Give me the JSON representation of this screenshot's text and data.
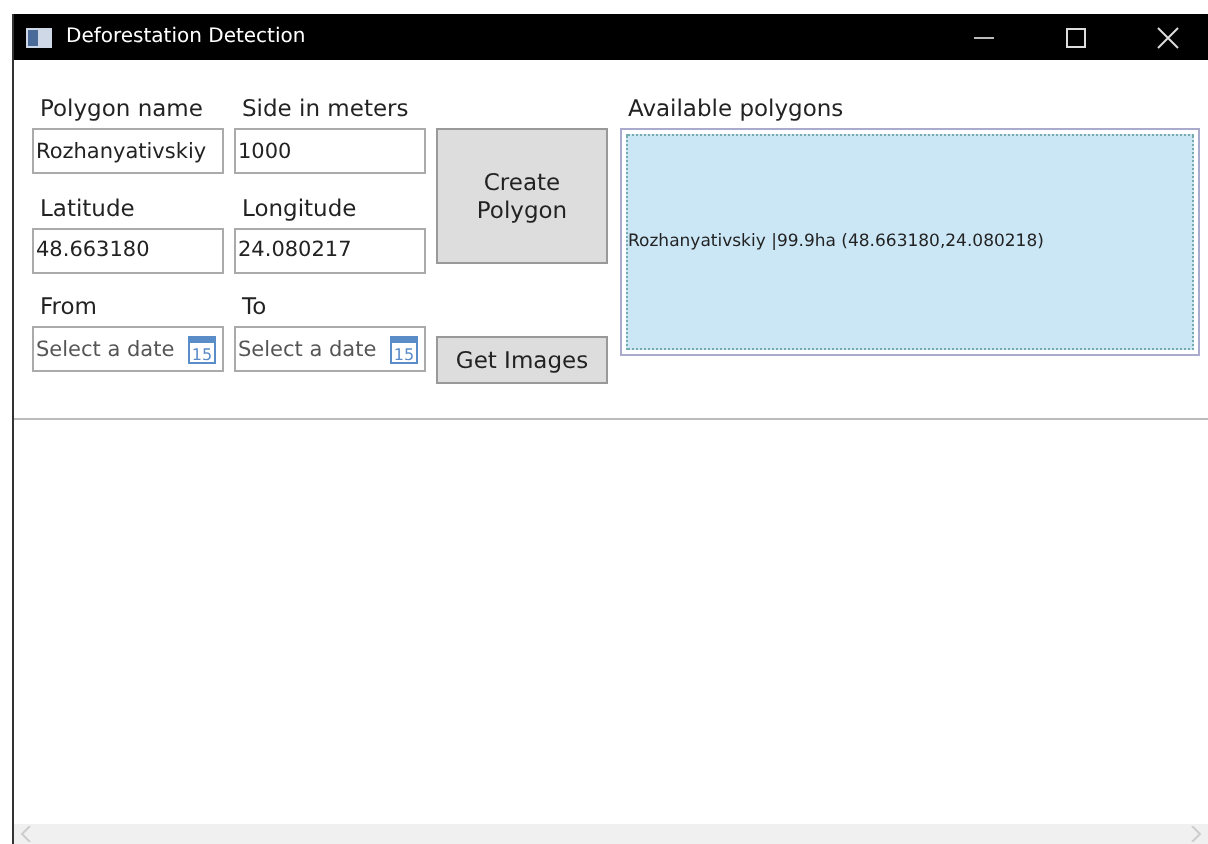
{
  "window": {
    "title": "Deforestation Detection"
  },
  "fields": [
    {
      "label": "Polygon name",
      "value": "Rozhanyativskiy",
      "kind": "text"
    },
    {
      "label": "Side in meters",
      "value": "1000",
      "kind": "text"
    },
    {
      "label": "Latitude",
      "value": "48.663180",
      "kind": "text"
    },
    {
      "label": "Longitude",
      "value": "24.080217",
      "kind": "text"
    },
    {
      "label": "From",
      "placeholder": "Select a date",
      "icon_text": "15",
      "kind": "date"
    },
    {
      "label": "To",
      "placeholder": "Select a date",
      "icon_text": "15",
      "kind": "date"
    }
  ],
  "buttons": [
    "Create Polygon",
    "Get Images"
  ],
  "polygons": {
    "label": "Available polygons",
    "items": [
      {
        "text": "Rozhanyativskiy |99.9ha (48.663180,24.080218)",
        "selected": true
      }
    ]
  }
}
